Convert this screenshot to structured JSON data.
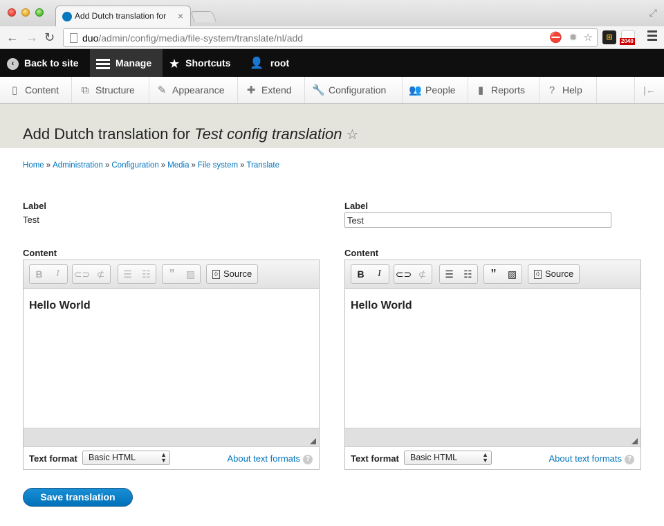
{
  "browser": {
    "tab_title": "Add Dutch translation for",
    "url_host": "duo",
    "url_path": "/admin/config/media/file-system/translate/nl/add",
    "badge": "2040"
  },
  "toolbar": {
    "back_label": "Back to site",
    "manage_label": "Manage",
    "shortcuts_label": "Shortcuts",
    "user_label": "root"
  },
  "tray": {
    "items": [
      {
        "label": "Content",
        "icon": "file-icon"
      },
      {
        "label": "Structure",
        "icon": "sitemap-icon"
      },
      {
        "label": "Appearance",
        "icon": "paintbrush-icon"
      },
      {
        "label": "Extend",
        "icon": "puzzle-icon"
      },
      {
        "label": "Configuration",
        "icon": "wrench-icon"
      },
      {
        "label": "People",
        "icon": "people-icon"
      },
      {
        "label": "Reports",
        "icon": "bar-chart-icon"
      },
      {
        "label": "Help",
        "icon": "help-icon"
      }
    ]
  },
  "page": {
    "title_prefix": "Add Dutch translation for",
    "title_em": "Test config translation"
  },
  "breadcrumb": [
    "Home",
    "Administration",
    "Configuration",
    "Media",
    "File system",
    "Translate"
  ],
  "source": {
    "label_heading": "Label",
    "label_value": "Test",
    "content_heading": "Content",
    "content_text": "Hello World",
    "format_label": "Text format",
    "format_value": "Basic HTML",
    "format_help": "About text formats"
  },
  "translation": {
    "label_heading": "Label",
    "label_value": "Test",
    "content_heading": "Content",
    "content_text": "Hello World",
    "format_label": "Text format",
    "format_value": "Basic HTML",
    "format_help": "About text formats"
  },
  "editor": {
    "source_button": "Source"
  },
  "actions": {
    "save_label": "Save translation"
  },
  "colors": {
    "link": "#0074bd",
    "primary_button": "#0071b8",
    "toolbar_bg": "#0f0f0f",
    "header_bg": "#e4e4dd"
  }
}
